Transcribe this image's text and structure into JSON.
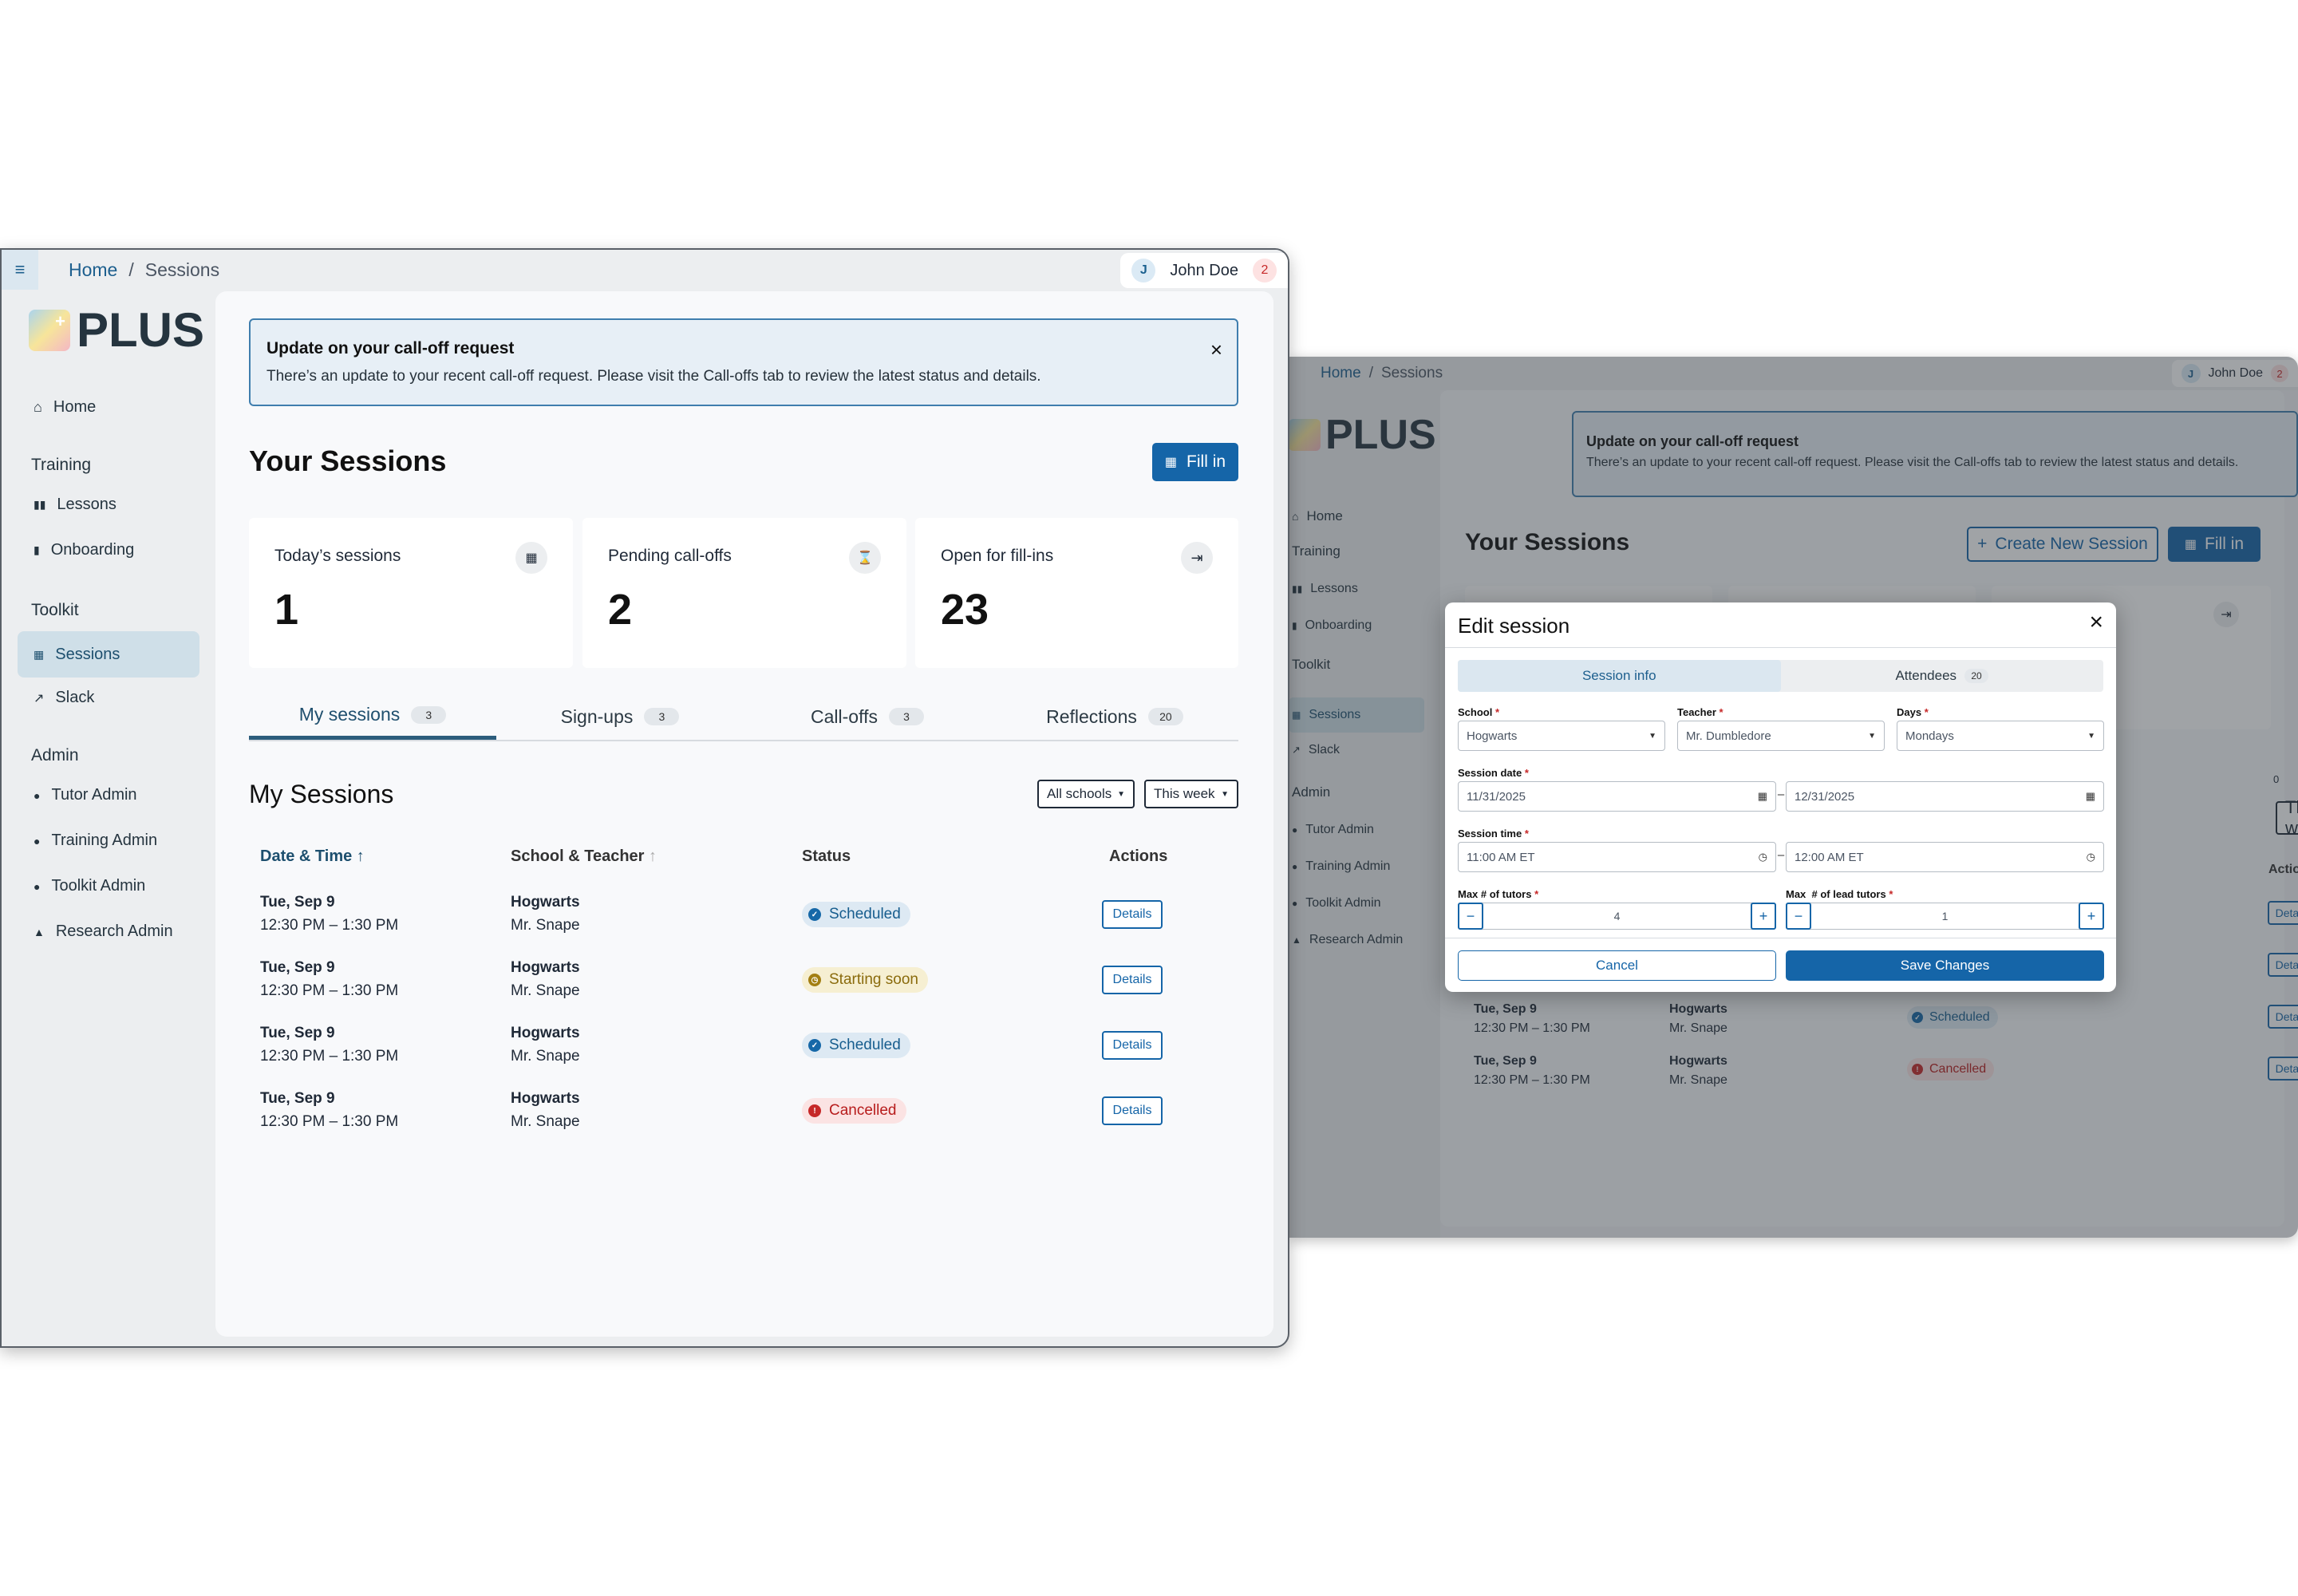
{
  "app": {
    "logo_text": "PLUS"
  },
  "breadcrumb": {
    "home": "Home",
    "separator": "/",
    "current": "Sessions"
  },
  "user": {
    "initial": "J",
    "name": "John Doe",
    "notifications": "2"
  },
  "sidebar": {
    "home": "Home",
    "sections": {
      "training": "Training",
      "toolkit": "Toolkit",
      "admin": "Admin"
    },
    "training_items": [
      "Lessons",
      "Onboarding"
    ],
    "toolkit_items": [
      "Sessions",
      "Slack"
    ],
    "admin_items": [
      "Tutor Admin",
      "Training Admin",
      "Toolkit Admin",
      "Research Admin"
    ]
  },
  "alert": {
    "title": "Update on your call-off request",
    "body": "There’s an update to your recent call-off request. Please visit the Call-offs tab to review the latest status and details.",
    "close": "×"
  },
  "page": {
    "title": "Your Sessions",
    "fill_in": "Fill in",
    "create_new": "Create New Session"
  },
  "stats": [
    {
      "label": "Today’s sessions",
      "value": "1",
      "icon": "calendar-icon"
    },
    {
      "label": "Pending call-offs",
      "value": "2",
      "icon": "hourglass-icon"
    },
    {
      "label": "Open for fill-ins",
      "value": "23",
      "icon": "sign-in-icon"
    }
  ],
  "tabs": [
    {
      "label": "My sessions",
      "count": "3"
    },
    {
      "label": "Sign-ups",
      "count": "3"
    },
    {
      "label": "Call-offs",
      "count": "3"
    },
    {
      "label": "Reflections",
      "count": "20"
    }
  ],
  "section": {
    "title": "My Sessions",
    "filter_school": "All schools",
    "filter_week": "This week"
  },
  "table": {
    "headers": {
      "date": "Date & Time",
      "school": "School & Teacher",
      "status": "Status",
      "actions": "Actions"
    },
    "rows": [
      {
        "date": "Tue, Sep 9",
        "time": "12:30 PM – 1:30 PM",
        "school": "Hogwarts",
        "teacher": "Mr. Snape",
        "status": "Scheduled",
        "action": "Details"
      },
      {
        "date": "Tue, Sep 9",
        "time": "12:30 PM – 1:30 PM",
        "school": "Hogwarts",
        "teacher": "Mr. Snape",
        "status": "Starting soon",
        "action": "Details"
      },
      {
        "date": "Tue, Sep 9",
        "time": "12:30 PM – 1:30 PM",
        "school": "Hogwarts",
        "teacher": "Mr. Snape",
        "status": "Scheduled",
        "action": "Details"
      },
      {
        "date": "Tue, Sep 9",
        "time": "12:30 PM – 1:30 PM",
        "school": "Hogwarts",
        "teacher": "Mr. Snape",
        "status": "Cancelled",
        "action": "Details"
      }
    ]
  },
  "modal": {
    "title": "Edit session",
    "close": "×",
    "tabs": [
      {
        "label": "Session info"
      },
      {
        "label": "Attendees",
        "count": "20"
      }
    ],
    "labels": {
      "school": "School",
      "teacher": "Teacher",
      "days": "Days",
      "session_date": "Session date",
      "session_time": "Session time",
      "max_tutors": "Max # of tutors",
      "max_lead": "Max  # of lead tutors",
      "required": "*",
      "dash": "–"
    },
    "values": {
      "school": "Hogwarts",
      "teacher": "Mr. Dumbledore",
      "days": "Mondays",
      "date_start": "11/31/2025",
      "date_end": "12/31/2025",
      "time_start": "11:00 AM ET",
      "time_end": "12:00 AM ET",
      "max_tutors": "4",
      "max_lead": "1"
    },
    "minus": "−",
    "plus": "+",
    "cancel": "Cancel",
    "save": "Save Changes"
  },
  "colors": {
    "primary": "#1565a8",
    "scheduled": "#1668a8",
    "starting_soon": "#a37f12",
    "cancelled": "#c62828"
  },
  "partial": {
    "pill_fragment": "0",
    "header_actions": "Actions"
  }
}
